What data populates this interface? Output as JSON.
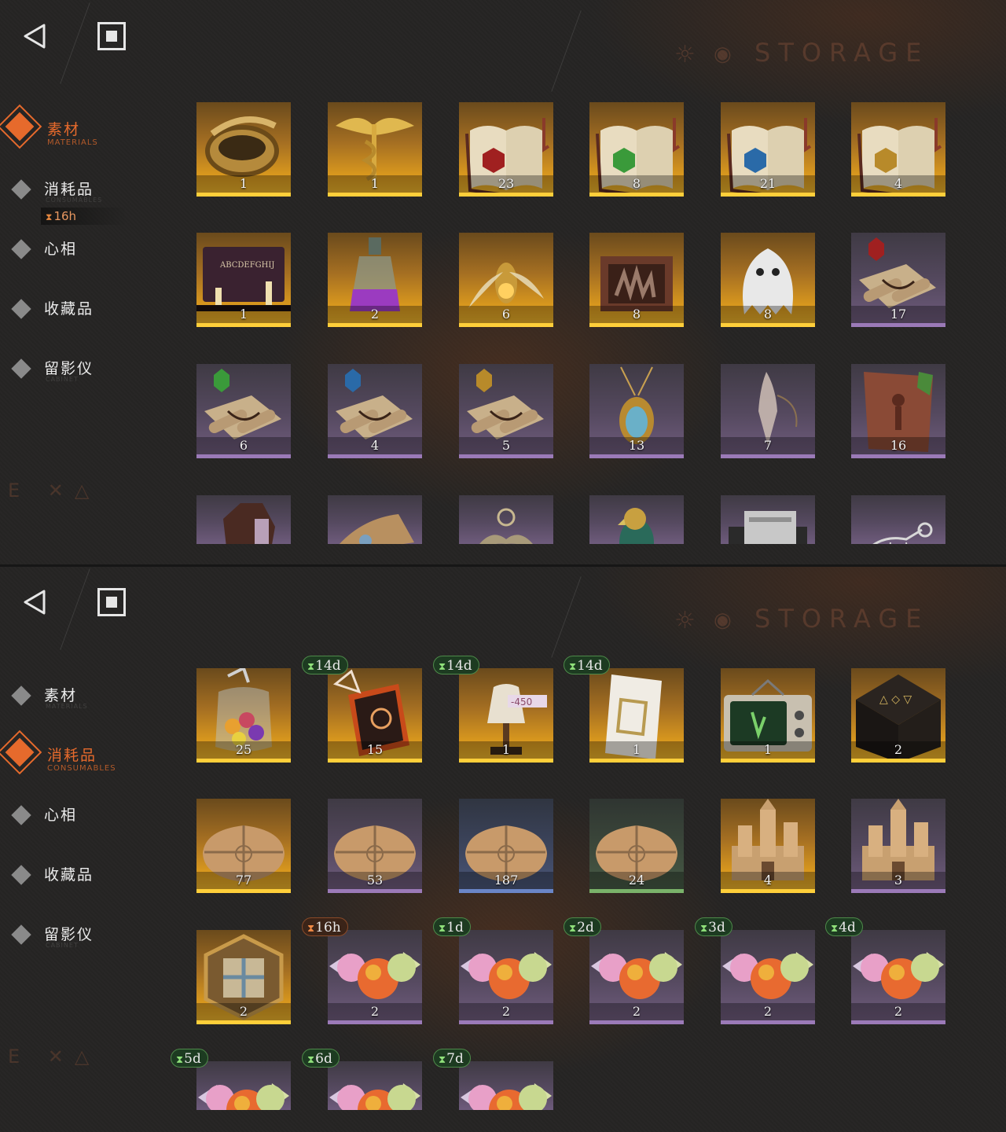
{
  "header": {
    "banner_title": "STORAGE"
  },
  "panels": [
    {
      "nav": [
        {
          "label": "素材",
          "sub": "MATERIALS",
          "active": true
        },
        {
          "label": "消耗品",
          "sub": "CONSUMABLES",
          "active": false
        },
        {
          "label": "心相",
          "sub": "",
          "active": false
        },
        {
          "label": "收藏品",
          "sub": "",
          "active": false
        },
        {
          "label": "留影仪",
          "sub": "CABINET",
          "active": false
        }
      ],
      "nav_badge": "16h",
      "items": [
        {
          "icon": "golden-ring-icon",
          "count": "1",
          "rarity": "gold"
        },
        {
          "icon": "caduceus-icon",
          "count": "1",
          "rarity": "gold"
        },
        {
          "icon": "red-rune-book-icon",
          "count": "23",
          "rarity": "gold"
        },
        {
          "icon": "green-rune-book-icon",
          "count": "8",
          "rarity": "gold"
        },
        {
          "icon": "blue-rune-book-icon",
          "count": "21",
          "rarity": "gold"
        },
        {
          "icon": "gold-rune-book-icon",
          "count": "4",
          "rarity": "gold"
        },
        {
          "icon": "ouija-board-icon",
          "count": "1",
          "rarity": "gold"
        },
        {
          "icon": "potion-bottle-icon",
          "count": "2",
          "rarity": "gold"
        },
        {
          "icon": "firefly-icon",
          "count": "6",
          "rarity": "gold"
        },
        {
          "icon": "hand-box-icon",
          "count": "8",
          "rarity": "gold"
        },
        {
          "icon": "ghost-icon",
          "count": "8",
          "rarity": "gold"
        },
        {
          "icon": "red-scroll-icon",
          "count": "17",
          "rarity": "lav"
        },
        {
          "icon": "green-scroll-icon",
          "count": "6",
          "rarity": "lav"
        },
        {
          "icon": "blue-scroll-icon",
          "count": "4",
          "rarity": "lav"
        },
        {
          "icon": "gold-scroll-icon",
          "count": "5",
          "rarity": "lav"
        },
        {
          "icon": "scarab-amulet-icon",
          "count": "13",
          "rarity": "lav"
        },
        {
          "icon": "crystal-pendulum-icon",
          "count": "7",
          "rarity": "lav"
        },
        {
          "icon": "stone-tablet-icon",
          "count": "16",
          "rarity": "lav"
        },
        {
          "icon": "coffin-icon",
          "count": "",
          "rarity": "lav"
        },
        {
          "icon": "metal-device-icon",
          "count": "",
          "rarity": "lav"
        },
        {
          "icon": "winged-key-icon",
          "count": "",
          "rarity": "lav"
        },
        {
          "icon": "parrot-icon",
          "count": "",
          "rarity": "lav"
        },
        {
          "icon": "silver-box-icon",
          "count": "",
          "rarity": "lav"
        },
        {
          "icon": "skeleton-icon",
          "count": "",
          "rarity": "lav"
        }
      ]
    },
    {
      "nav": [
        {
          "label": "素材",
          "sub": "MATERIALS",
          "active": false
        },
        {
          "label": "消耗品",
          "sub": "CONSUMABLES",
          "active": true
        },
        {
          "label": "心相",
          "sub": "",
          "active": false
        },
        {
          "label": "收藏品",
          "sub": "",
          "active": false
        },
        {
          "label": "留影仪",
          "sub": "CABINET",
          "active": false
        }
      ],
      "items": [
        {
          "icon": "candy-jar-icon",
          "count": "25",
          "rarity": "gold",
          "timer": ""
        },
        {
          "icon": "tarot-card-icon",
          "count": "15",
          "rarity": "gold",
          "timer": "14d",
          "timer_color": "green"
        },
        {
          "icon": "mannequin-icon",
          "count": "1",
          "rarity": "gold",
          "timer": "14d",
          "timer_color": "green"
        },
        {
          "icon": "shopping-list-icon",
          "count": "1",
          "rarity": "gold",
          "timer": "14d",
          "timer_color": "green"
        },
        {
          "icon": "television-icon",
          "count": "1",
          "rarity": "gold",
          "timer": ""
        },
        {
          "icon": "rune-table-icon",
          "count": "2",
          "rarity": "gold",
          "timer": ""
        },
        {
          "icon": "parcel-icon",
          "count": "77",
          "rarity": "gold",
          "timer": ""
        },
        {
          "icon": "parcel-icon",
          "count": "53",
          "rarity": "lav",
          "timer": ""
        },
        {
          "icon": "parcel-icon",
          "count": "187",
          "rarity": "blue",
          "timer": ""
        },
        {
          "icon": "parcel-icon",
          "count": "24",
          "rarity": "green",
          "timer": ""
        },
        {
          "icon": "sandcastle-icon",
          "count": "4",
          "rarity": "gold",
          "timer": ""
        },
        {
          "icon": "sandcastle-icon",
          "count": "3",
          "rarity": "lav",
          "timer": ""
        },
        {
          "icon": "puzzle-badge-icon",
          "count": "2",
          "rarity": "gold",
          "timer": ""
        },
        {
          "icon": "candy-icon",
          "count": "2",
          "rarity": "lav",
          "timer": "16h",
          "timer_color": "orange"
        },
        {
          "icon": "candy-icon",
          "count": "2",
          "rarity": "lav",
          "timer": "1d",
          "timer_color": "green"
        },
        {
          "icon": "candy-icon",
          "count": "2",
          "rarity": "lav",
          "timer": "2d",
          "timer_color": "green"
        },
        {
          "icon": "candy-icon",
          "count": "2",
          "rarity": "lav",
          "timer": "3d",
          "timer_color": "green"
        },
        {
          "icon": "candy-icon",
          "count": "2",
          "rarity": "lav",
          "timer": "4d",
          "timer_color": "green"
        },
        {
          "icon": "candy-icon",
          "count": "",
          "rarity": "lav",
          "timer": "5d",
          "timer_color": "green"
        },
        {
          "icon": "candy-icon",
          "count": "",
          "rarity": "lav",
          "timer": "6d",
          "timer_color": "green"
        },
        {
          "icon": "candy-icon",
          "count": "",
          "rarity": "lav",
          "timer": "7d",
          "timer_color": "green"
        }
      ]
    }
  ]
}
